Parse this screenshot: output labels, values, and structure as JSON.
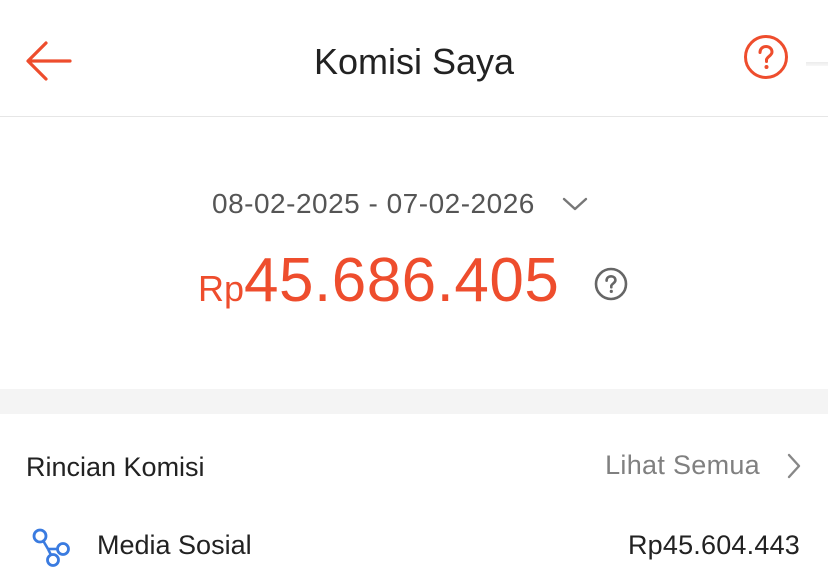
{
  "header": {
    "title": "Komisi Saya"
  },
  "summary": {
    "date_range": "08-02-2025 - 07-02-2026",
    "currency": "Rp",
    "amount": "45.686.405"
  },
  "details": {
    "title": "Rincian Komisi",
    "see_all": "Lihat Semua",
    "items": [
      {
        "label": "Media Sosial",
        "value": "Rp45.604.443",
        "icon": "social-network-icon"
      }
    ]
  },
  "colors": {
    "accent": "#ee4d2d",
    "icon_blue": "#3a7be0"
  }
}
